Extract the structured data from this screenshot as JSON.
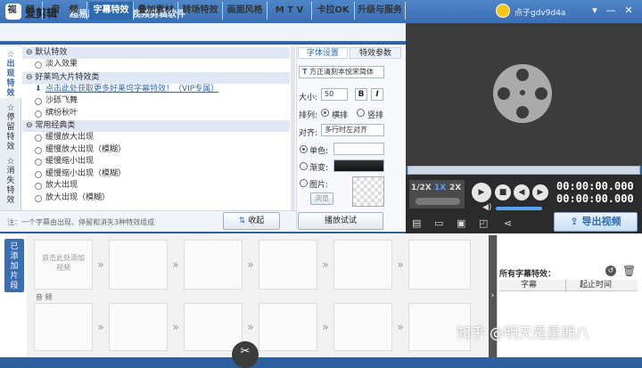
{
  "titlebar": {
    "app_name": "爱剪辑",
    "slogan": "超易用、强大的视频剪辑软件",
    "username": "点子gdv9d4a"
  },
  "tabs": [
    "视　频",
    "音　频",
    "字幕特效",
    "叠加素材",
    "转场特效",
    "画面风格",
    "M T V",
    "卡拉OK",
    "升级与服务"
  ],
  "active_tab": "字幕特效",
  "side_tabs": [
    "出现特效",
    "停留特效",
    "消失特效"
  ],
  "effects": {
    "groups": [
      {
        "title": "默认特效",
        "items": [
          {
            "label": "淡入效果",
            "type": "radio"
          }
        ]
      },
      {
        "title": "好莱坞大片特效类",
        "items": [
          {
            "label": "点击此处获取更多好莱坞字幕特效！（VIP专属）",
            "type": "link"
          },
          {
            "label": "沙砾飞舞",
            "type": "radio"
          },
          {
            "label": "缤纷秋叶",
            "type": "radio"
          }
        ]
      },
      {
        "title": "常用经典类",
        "items": [
          {
            "label": "缓慢放大出现",
            "type": "radio"
          },
          {
            "label": "缓慢放大出现（模糊）",
            "type": "radio"
          },
          {
            "label": "缓慢缩小出现",
            "type": "radio"
          },
          {
            "label": "缓慢缩小出现（模糊）",
            "type": "radio"
          },
          {
            "label": "放大出现",
            "type": "radio"
          },
          {
            "label": "放大出现（模糊）",
            "type": "radio"
          }
        ]
      }
    ]
  },
  "hint": "注：一个字幕由出现、停留和消失3种特效组成",
  "collapse_label": "收起",
  "settings": {
    "tab_font": "字体设置",
    "tab_effect": "特效参数",
    "font_name": "方正清刻本悦宋简体",
    "size_label": "大小:",
    "size_value": "50",
    "bold": "B",
    "italic": "I",
    "layout_label": "排列:",
    "horizontal": "横排",
    "vertical": "竖排",
    "align_label": "对齐:",
    "align_value": "多行时左对齐",
    "solid_label": "单色:",
    "gradient_label": "渐变:",
    "image_label": "图片:",
    "browse": "浏览",
    "play_test": "播放试试"
  },
  "player": {
    "speed_half": "1/2X",
    "speed_1": "1X",
    "speed_2": "2X",
    "time_current": "00:00:00.000",
    "time_total": "00:00:00.000",
    "export": "导出视频"
  },
  "bottom": {
    "added_tab": "已添加片段",
    "add_hint": "双击此处添加视频",
    "audio_label": "音 频",
    "sub_header": "所有字幕特效：",
    "col_sub": "字幕",
    "col_time": "起止时间"
  },
  "watermark": "知乎 @明天是星期八"
}
